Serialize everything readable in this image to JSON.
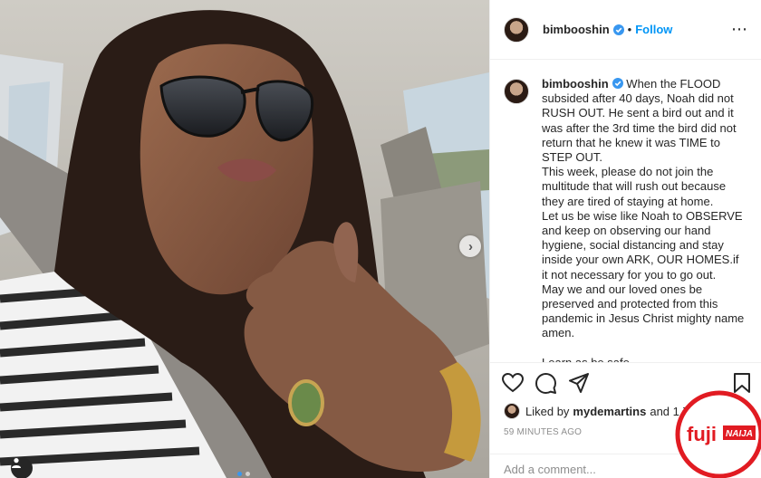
{
  "post": {
    "author": "bimbooshin",
    "follow_label": "Follow",
    "caption": "When the FLOOD subsided after 40 days, Noah did not RUSH OUT. He sent a bird out and it was after the 3rd time the bird did not return that he knew it was TIME to STEP OUT.\nThis week, please do not join the multitude that will rush out because they are tired of staying at home.\nLet us be wise like Noah to OBSERVE and keep on observing our hand hygiene, social distancing and stay inside your own ARK, OUR HOMES.if it not necessary for you to go out.\nMay we and our loved ones be preserved and protected from this pandemic in Jesus Christ mighty name amen.\n\nLearn as be safe",
    "liked_by_prefix": "Liked by",
    "liked_by_user": "mydemartins",
    "liked_by_suffix": "and 1,7",
    "time_ago": "59 MINUTES AGO",
    "comment_placeholder": "Add a comment..."
  },
  "icons": {
    "verified": "verified-badge-icon",
    "like": "heart-icon",
    "comment": "comment-icon",
    "share": "share-icon",
    "save": "bookmark-icon",
    "more": "more-options-icon",
    "carousel": "chevron-right-icon",
    "tag": "user-tag-icon"
  },
  "watermark": {
    "brand": "fuji",
    "brand_tag": "NAIJA"
  },
  "colors": {
    "link": "#0095f6",
    "verified": "#3897f0",
    "watermark_red": "#e11b22"
  }
}
